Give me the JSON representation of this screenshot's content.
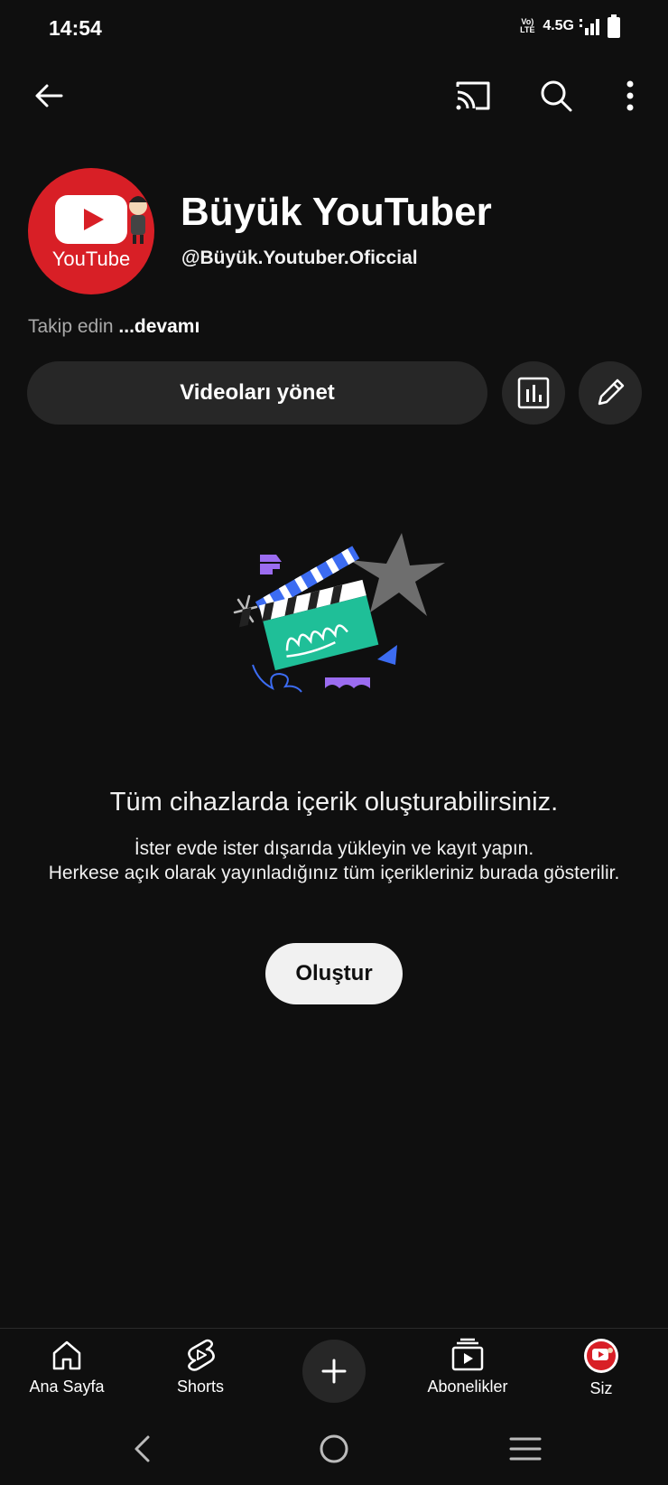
{
  "status_bar": {
    "time": "14:54",
    "volte": "Vo) LTE",
    "network": "4.5G"
  },
  "app_bar": {
    "icons": [
      "back-arrow-icon",
      "cast-icon",
      "search-icon",
      "more-vert-icon"
    ]
  },
  "channel": {
    "avatar_text": "YouTube",
    "name": "Büyük YouTuber",
    "handle": "@Büyük.Youtuber.Oficcial",
    "about_text": "Takip edin",
    "more_label": "...devamı"
  },
  "actions": {
    "manage_label": "Videoları yönet"
  },
  "empty_state": {
    "title": "Tüm cihazlarda içerik oluşturabilirsiniz.",
    "line1": "İster evde ister dışarıda yükleyin ve kayıt yapın.",
    "line2": "Herkese açık olarak yayınladığınız tüm içerikleriniz burada gösterilir.",
    "button_label": "Oluştur"
  },
  "bottom_nav": {
    "items": [
      {
        "label": "Ana Sayfa",
        "icon": "home-icon"
      },
      {
        "label": "Shorts",
        "icon": "shorts-icon"
      },
      {
        "label": "",
        "icon": "plus-icon"
      },
      {
        "label": "Abonelikler",
        "icon": "subscriptions-icon"
      },
      {
        "label": "Siz",
        "icon": "avatar"
      }
    ]
  },
  "colors": {
    "background": "#0f0f0f",
    "chip": "#272727",
    "brand_red": "#d81f26",
    "teal": "#1fbf98",
    "purple": "#9b6cf0",
    "blue": "#3c6cf2"
  }
}
